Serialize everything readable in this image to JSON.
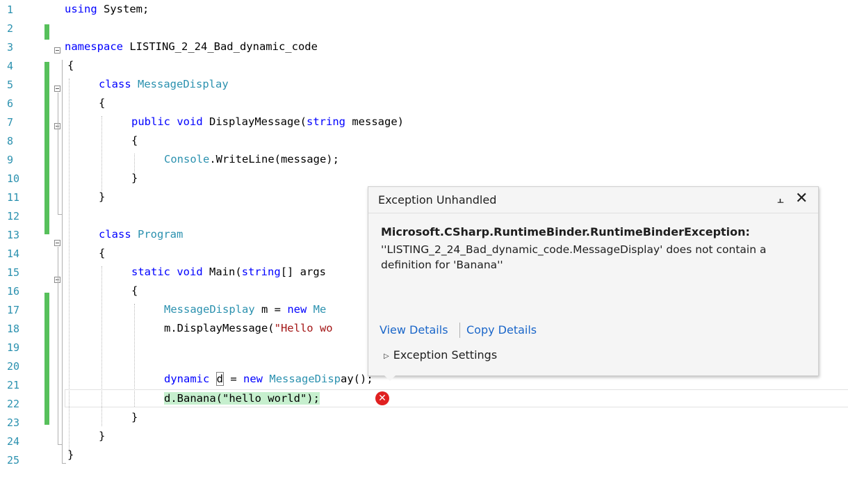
{
  "editor": {
    "line_numbers": [
      "1",
      "2",
      "3",
      "4",
      "5",
      "6",
      "7",
      "8",
      "9",
      "10",
      "11",
      "12",
      "13",
      "14",
      "15",
      "16",
      "17",
      "18",
      "19",
      "20",
      "21",
      "22",
      "23",
      "24",
      "25"
    ],
    "code": {
      "l1_kw": "using",
      "l1_rest": " System;",
      "l3_kw": "namespace",
      "l3_rest": " LISTING_2_24_Bad_dynamic_code",
      "l4": "{",
      "l5_kw": "class",
      "l5_ty": "MessageDisplay",
      "l6": "{",
      "l7_kw1": "public",
      "l7_kw2": "void",
      "l7_name": "DisplayMessage(",
      "l7_kw3": "string",
      "l7_rest": " message)",
      "l8": "{",
      "l9_ty": "Console",
      "l9_rest": ".WriteLine(message);",
      "l10": "}",
      "l11": "}",
      "l13_kw": "class",
      "l13_ty": "Program",
      "l14": "{",
      "l15_kw1": "static",
      "l15_kw2": "void",
      "l15_name": "Main(",
      "l15_kw3": "string",
      "l15_rest": "[] args",
      "l16": "{",
      "l17_ty": "MessageDisplay",
      "l17_mid": " m = ",
      "l17_kw": "new",
      "l17_ty2": "Me",
      "l18_pre": "m.DisplayMessage(",
      "l18_str": "\"Hello wo",
      "l20_kw": "dynamic",
      "l20_var": "d",
      "l20_eq": " = ",
      "l20_kw2": "new",
      "l20_ty": "MessageDisp",
      "l20_rest": "ay();",
      "l21": "d.Banana(\"hello world\");",
      "l22": "}",
      "l23": "}",
      "l24": "}"
    }
  },
  "exception_popup": {
    "title": "Exception Unhandled",
    "pin_glyph": "⫠",
    "close_glyph": "✕",
    "exception_type": "Microsoft.CSharp.RuntimeBinder.RuntimeBinderException:",
    "message": "''LISTING_2_24_Bad_dynamic_code.MessageDisplay' does not contain a definition for 'Banana''",
    "view_details": "View Details",
    "copy_details": "Copy Details",
    "exception_settings": "Exception Settings",
    "triangle_glyph": "▷"
  },
  "error_icon_glyph": "✕",
  "colors": {
    "keyword": "#0000ff",
    "type": "#2b91af",
    "string": "#a31515",
    "change_bar": "#57c05b",
    "error": "#e02020",
    "link": "#1a66c9"
  }
}
